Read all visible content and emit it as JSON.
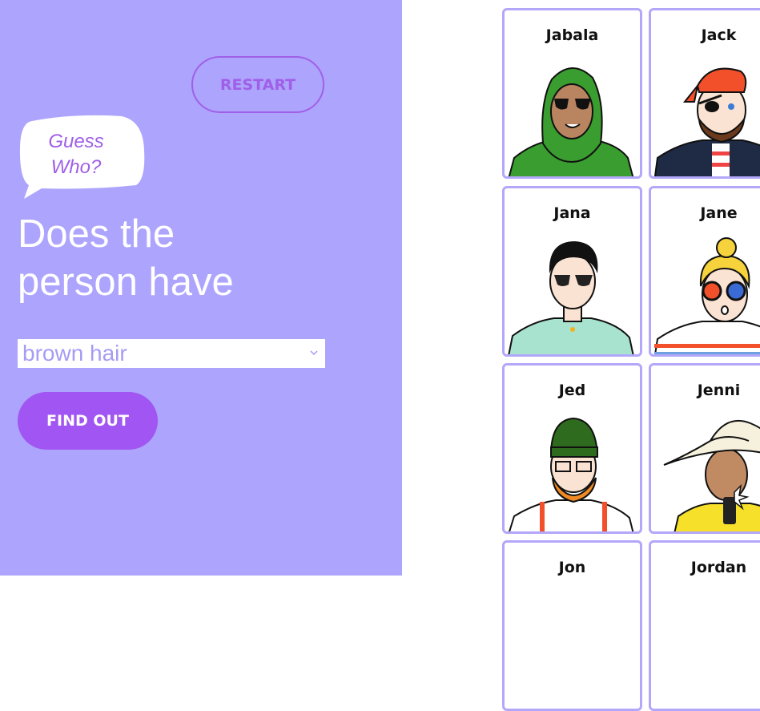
{
  "panel": {
    "restart_label": "RESTART",
    "bubble_line1": "Guess",
    "bubble_line2": "Who?",
    "question_line1": "Does the",
    "question_line2": "person have",
    "select_value": "brown hair",
    "find_label": "FIND OUT"
  },
  "cards": [
    {
      "name": "Jabala"
    },
    {
      "name": "Jack"
    },
    {
      "name": "Jana"
    },
    {
      "name": "Jane"
    },
    {
      "name": "Jed"
    },
    {
      "name": "Jenni"
    },
    {
      "name": "Jon"
    },
    {
      "name": "Jordan"
    }
  ],
  "colors": {
    "panel_bg": "#ada4fd",
    "accent": "#a155f2",
    "card_border": "#b3a7fa"
  }
}
